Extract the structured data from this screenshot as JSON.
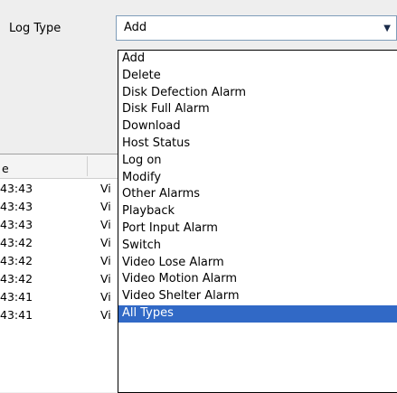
{
  "filter": {
    "log_type_label": "Log Type",
    "log_type_value": "Add"
  },
  "table": {
    "header_time": "e",
    "rows": [
      {
        "time": "43:43",
        "device": "Vi"
      },
      {
        "time": "43:43",
        "device": "Vi"
      },
      {
        "time": "43:43",
        "device": "Vi"
      },
      {
        "time": "43:42",
        "device": "Vi"
      },
      {
        "time": "43:42",
        "device": "Vi"
      },
      {
        "time": "43:42",
        "device": "Vi"
      },
      {
        "time": "43:41",
        "device": "Vi"
      },
      {
        "time": "43:41",
        "device": "Vi"
      }
    ]
  },
  "dropdown": {
    "options": [
      "Add",
      "Delete",
      "Disk Defection Alarm",
      "Disk Full Alarm",
      "Download",
      "Host Status",
      "Log on",
      "Modify",
      "Other Alarms",
      "Playback",
      "Port Input Alarm",
      "Switch",
      "Video Lose Alarm",
      "Video Motion Alarm",
      "Video Shelter Alarm",
      "All Types"
    ],
    "highlighted": "All Types"
  },
  "colors": {
    "highlight": "#3169c6",
    "combo_border": "#7f9db9"
  }
}
